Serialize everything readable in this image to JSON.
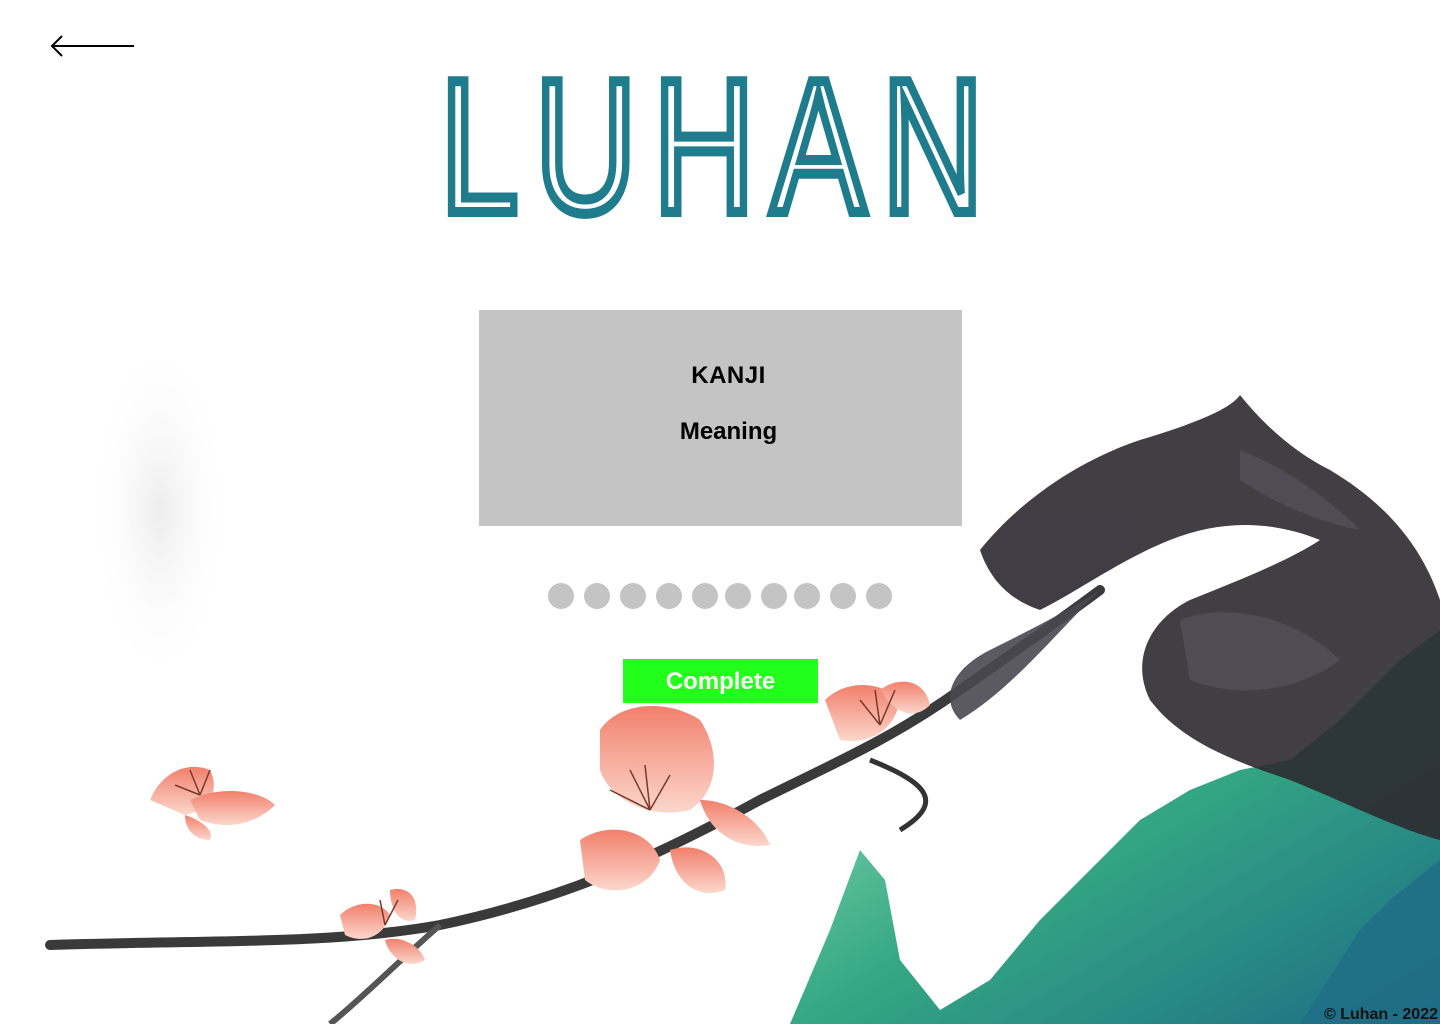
{
  "nav": {
    "back_icon": "left-arrow-icon"
  },
  "logo": {
    "text": "LUHAN",
    "color": "#1f7c8c"
  },
  "card": {
    "kanji": "KANJI",
    "meaning": "Meaning",
    "background": "#c4c4c4"
  },
  "progress": {
    "total": 10,
    "color": "#c4c4c4"
  },
  "complete_button": {
    "label": "Complete",
    "background": "#22ff1a",
    "text_color": "#ffffff"
  },
  "footer": {
    "copyright": "© Luhan - 2022"
  },
  "colors": {
    "blossom": "#f28c78",
    "ink": "#2c2a30",
    "mountain": "#2aa07e"
  }
}
